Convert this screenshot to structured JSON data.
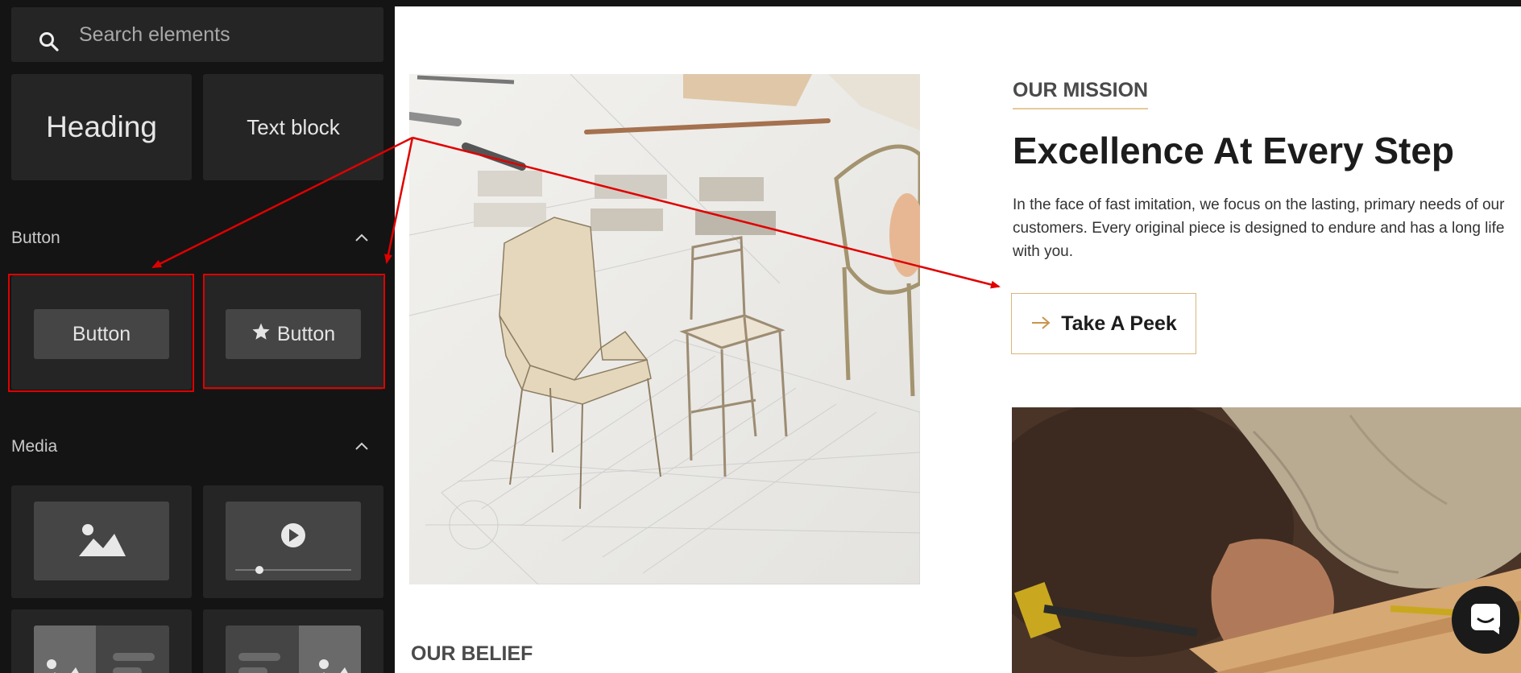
{
  "sidebar": {
    "search": {
      "placeholder": "Search elements",
      "value": ""
    },
    "elements": {
      "heading": "Heading",
      "text_block": "Text block"
    },
    "sections": {
      "button": {
        "title": "Button",
        "items": [
          {
            "label": "Button"
          },
          {
            "label": "Button"
          }
        ]
      },
      "media": {
        "title": "Media"
      }
    }
  },
  "canvas": {
    "mission_label": "OUR MISSION",
    "heading": "Excellence At Every Step",
    "paragraph": "In the face of fast imitation, we focus on the lasting, primary needs of our customers. Every original piece is designed to endure and has a long life with you.",
    "cta_label": "Take A Peek",
    "belief_label": "OUR BELIEF"
  },
  "colors": {
    "annotation_red": "#e00000",
    "cta_border": "#dbb67a",
    "sidebar_bg": "#141414",
    "tile_bg": "#252525"
  },
  "icons": [
    "search-icon",
    "chevron-up-icon",
    "star-icon",
    "image-icon",
    "play-icon",
    "arrow-right-icon",
    "chat-icon"
  ]
}
